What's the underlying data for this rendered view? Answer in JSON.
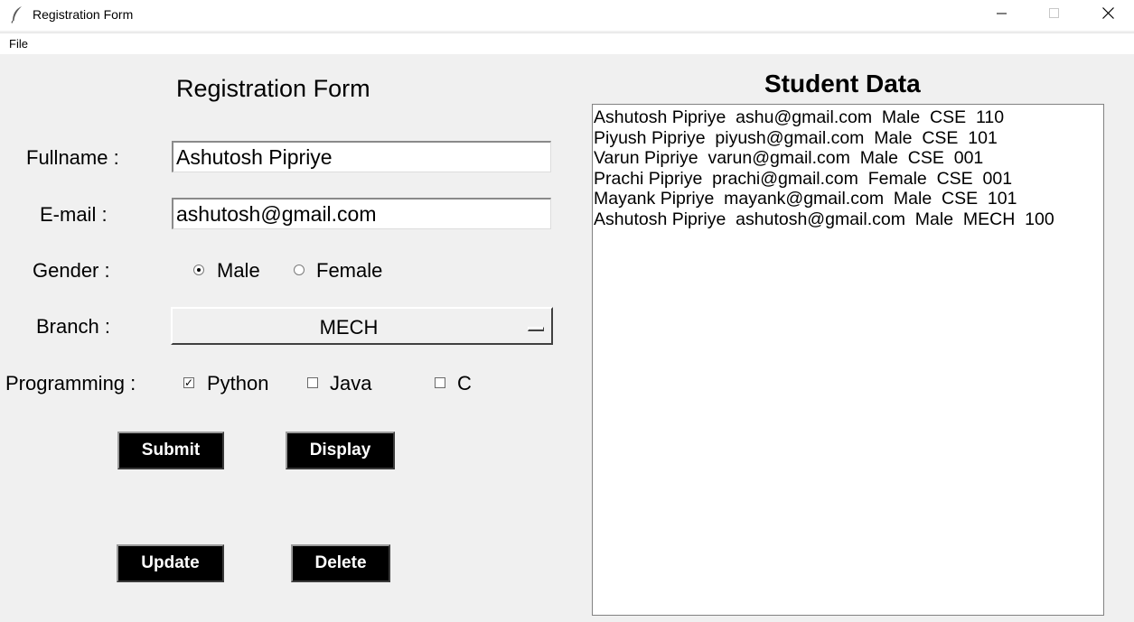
{
  "window": {
    "title": "Registration Form",
    "app_icon": "feather-icon",
    "minimize_icon": "minimize-icon",
    "maximize_icon": "maximize-icon",
    "close_icon": "close-icon"
  },
  "menu": {
    "file_label": "File"
  },
  "form": {
    "title": "Registration Form",
    "fullname": {
      "label": "Fullname :",
      "value": "Ashutosh Pipriye"
    },
    "email": {
      "label": "E-mail :",
      "value": "ashutosh@gmail.com"
    },
    "gender": {
      "label": "Gender :",
      "options": [
        {
          "label": "Male",
          "selected": true
        },
        {
          "label": "Female",
          "selected": false
        }
      ]
    },
    "branch": {
      "label": "Branch :",
      "selected": "MECH"
    },
    "programming": {
      "label": "Programming :",
      "options": [
        {
          "label": "Python",
          "checked": true
        },
        {
          "label": "Java",
          "checked": false
        },
        {
          "label": "C",
          "checked": false
        }
      ]
    },
    "buttons": {
      "submit": "Submit",
      "display": "Display",
      "update": "Update",
      "delete": "Delete"
    }
  },
  "student_data": {
    "title": "Student Data",
    "rows": [
      "Ashutosh Pipriye  ashu@gmail.com  Male  CSE  110",
      "Piyush Pipriye  piyush@gmail.com  Male  CSE  101",
      "Varun Pipriye  varun@gmail.com  Male  CSE  001",
      "Prachi Pipriye  prachi@gmail.com  Female  CSE  001",
      "Mayank Pipriye  mayank@gmail.com  Male  CSE  101",
      "Ashutosh Pipriye  ashutosh@gmail.com  Male  MECH  100"
    ]
  },
  "colors": {
    "window_bg": "#f0f0f0",
    "button_bg": "#000000",
    "button_text": "#ffffff"
  }
}
